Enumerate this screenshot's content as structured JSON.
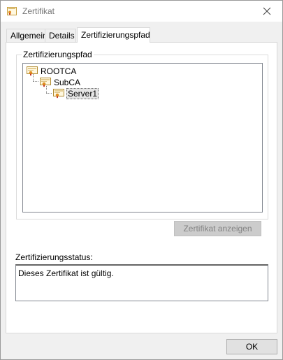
{
  "window": {
    "title": "Zertifikat"
  },
  "tabs": [
    {
      "label": "Allgemein"
    },
    {
      "label": "Details"
    },
    {
      "label": "Zertifizierungspfad"
    }
  ],
  "path": {
    "group_label": "Zertifizierungspfad",
    "nodes": [
      {
        "label": "ROOTCA"
      },
      {
        "label": "SubCA"
      },
      {
        "label": "Server1"
      }
    ],
    "view_button": "Zertifikat anzeigen"
  },
  "status": {
    "label": "Zertifizierungsstatus:",
    "text": "Dieses Zertifikat ist gültig."
  },
  "footer": {
    "ok_label": "OK"
  }
}
